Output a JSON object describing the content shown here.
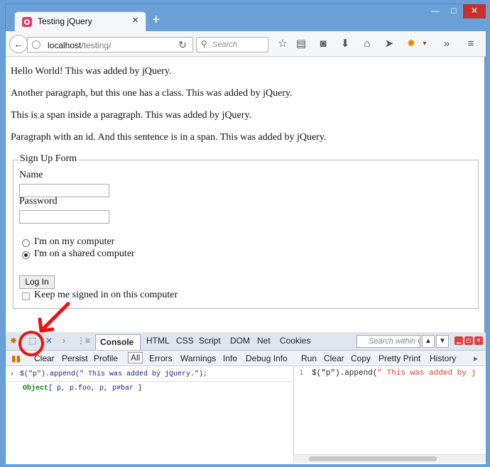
{
  "browser": {
    "tab_title": "Testing jQuery",
    "new_tab_label": "+",
    "url_host": "localhost",
    "url_path": "/testing/",
    "search_placeholder": "Search",
    "window_controls": [
      "—",
      "□",
      "✕"
    ],
    "icons": [
      "back-icon",
      "globe-icon",
      "reload-icon",
      "search-icon",
      "bookmark-star-icon",
      "reading-list-icon",
      "pocket-icon",
      "download-icon",
      "home-icon",
      "share-icon",
      "firebug-icon",
      "dropdown-icon",
      "overflow-icon",
      "menu-icon"
    ]
  },
  "page": {
    "paragraphs": [
      "Hello World! This was added by jQuery.",
      "Another paragraph, but this one has a class. This was added by jQuery.",
      "This is a span inside a paragraph. This was added by jQuery.",
      "Paragraph with an id. And this sentence is in a span. This was added by jQuery."
    ],
    "form": {
      "legend": "Sign Up Form",
      "name_label": "Name",
      "password_label": "Password",
      "radio_options": [
        {
          "label": "I'm on my computer",
          "checked": false
        },
        {
          "label": "I'm on a shared computer",
          "checked": true
        }
      ],
      "login_button": "Log In",
      "remember_label": "Keep me signed in on this computer"
    }
  },
  "firebug": {
    "main_tabs": [
      "Console",
      "HTML",
      "CSS",
      "Script",
      "DOM",
      "Net",
      "Cookies"
    ],
    "active_tab": "Console",
    "search_placeholder": "Search within C",
    "console_buttons": [
      "Clear",
      "Persist",
      "Profile",
      "All",
      "Errors",
      "Warnings",
      "Info",
      "Debug Info"
    ],
    "active_filter": "All",
    "editor_buttons": [
      "Run",
      "Clear",
      "Copy",
      "Pretty Print",
      "History"
    ],
    "command": "$(\"p\").append(\" This was added by jQuery.\");",
    "result_object": "Object",
    "result_items": "[ p, p.foo, p, p#bar ]",
    "editor_line_number": "1",
    "editor_code_prefix": "$(\"p\").append(",
    "editor_code_string": "\" This was added by j",
    "annotation_color": "#ee1111"
  }
}
